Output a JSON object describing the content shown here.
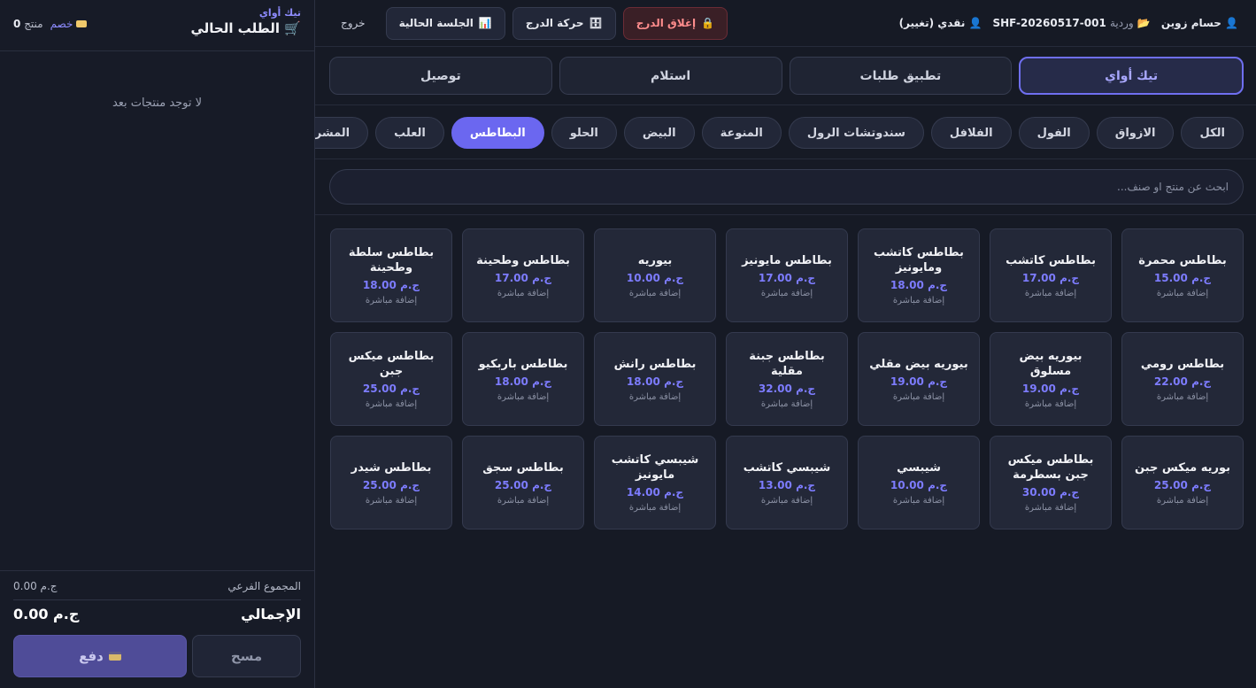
{
  "header": {
    "user_name": "حسام زوين",
    "shift_label": "وردية",
    "shift_id": "SHF-20260517-001",
    "payment_mode": "نقدي (تغيير)",
    "close_drawer": "إغلاق الدرج",
    "drawer_movement": "حركة الدرج",
    "current_session": "الجلسة الحالية",
    "logout": "خروج"
  },
  "order_types": [
    {
      "label": "تيك أواي",
      "active": true
    },
    {
      "label": "تطبيق طلبات",
      "active": false
    },
    {
      "label": "استلام",
      "active": false
    },
    {
      "label": "توصيل",
      "active": false
    }
  ],
  "categories": [
    {
      "label": "الكل"
    },
    {
      "label": "الازواق"
    },
    {
      "label": "الفول"
    },
    {
      "label": "الفلافل"
    },
    {
      "label": "سندوتشات الرول"
    },
    {
      "label": "المنوعة"
    },
    {
      "label": "البيض"
    },
    {
      "label": "الحلو"
    },
    {
      "label": "البطاطس",
      "active": true
    },
    {
      "label": "العلب"
    },
    {
      "label": "المشروبات"
    }
  ],
  "search": {
    "placeholder": "ابحث عن منتج او صنف..."
  },
  "add_label": "إضافة مباشرة",
  "products": [
    {
      "name": "بطاطس محمرة",
      "price": "ج.م 15.00"
    },
    {
      "name": "بطاطس كاتشب",
      "price": "ج.م 17.00"
    },
    {
      "name": "بطاطس كاتشب ومايونيز",
      "price": "ج.م 18.00"
    },
    {
      "name": "بطاطس مايونيز",
      "price": "ج.م 17.00"
    },
    {
      "name": "بيوريه",
      "price": "ج.م 10.00"
    },
    {
      "name": "بطاطس وطحينة",
      "price": "ج.م 17.00"
    },
    {
      "name": "بطاطس سلطة وطحينة",
      "price": "ج.م 18.00"
    },
    {
      "name": "بطاطس رومي",
      "price": "ج.م 22.00"
    },
    {
      "name": "بيوريه بيض مسلوق",
      "price": "ج.م 19.00"
    },
    {
      "name": "بيوريه بيض مقلي",
      "price": "ج.م 19.00"
    },
    {
      "name": "بطاطس جبنة مقلية",
      "price": "ج.م 32.00"
    },
    {
      "name": "بطاطس رانش",
      "price": "ج.م 18.00"
    },
    {
      "name": "بطاطس باربكيو",
      "price": "ج.م 18.00"
    },
    {
      "name": "بطاطس ميكس جبن",
      "price": "ج.م 25.00"
    },
    {
      "name": "بوريه ميكس جبن",
      "price": "ج.م 25.00"
    },
    {
      "name": "بطاطس ميكس جبن بسطرمة",
      "price": "ج.م 30.00"
    },
    {
      "name": "شيبسي",
      "price": "ج.م 10.00"
    },
    {
      "name": "شيبسي كاتشب",
      "price": "ج.م 13.00"
    },
    {
      "name": "شيبسي كاتشب مايونيز",
      "price": "ج.م 14.00"
    },
    {
      "name": "بطاطس سجق",
      "price": "ج.م 25.00"
    },
    {
      "name": "بطاطس شيدر",
      "price": "ج.م 25.00"
    }
  ],
  "cart": {
    "order_type": "تيك أواي",
    "title": "الطلب الحالي",
    "discount": "خصم",
    "item_count": "0",
    "item_unit": "منتج",
    "empty": "لا توجد منتجات بعد",
    "subtotal_label": "المجموع الفرعي",
    "subtotal_value": "ج.م 0.00",
    "total_label": "الإجمالي",
    "total_value": "ج.م 0.00",
    "clear": "مسح",
    "pay": "دفع"
  },
  "colors": {
    "accent": "#6b67f0",
    "danger": "#ff8d8d",
    "background": "#161a25"
  }
}
